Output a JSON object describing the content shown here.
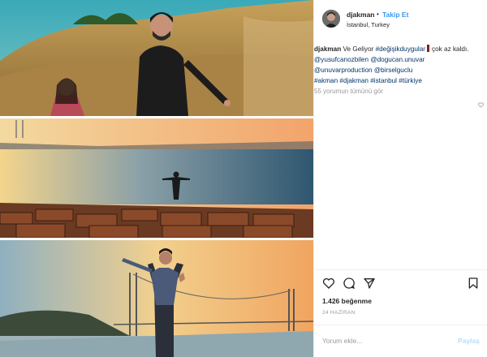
{
  "header": {
    "username": "djakman",
    "separator": "•",
    "follow_label": "Takip Et",
    "location": "İstanbul, Turkey"
  },
  "caption": {
    "username": "djakman",
    "text1": "Ve Geliyor",
    "hashtag1": "#değişikduygular",
    "text2": "çok az kaldı.",
    "mention1": "@yusufcanozbilen",
    "mention2": "@dogucan.unuvar",
    "mention3": "@unuvarproduction",
    "mention4": "@birselguclu",
    "hashtag2": "#akman",
    "hashtag3": "#djakman",
    "hashtag4": "#istanbul",
    "hashtag5": "#türkiye",
    "view_all": "55 yorumun tümünü gör"
  },
  "stats": {
    "likes": "1.426 beğenme",
    "date": "24 HAZİRAN"
  },
  "comment_box": {
    "placeholder": "Yorum ekle...",
    "post_label": "Paylaş"
  },
  "icons": [
    "heart-icon",
    "comment-icon",
    "share-icon",
    "bookmark-icon",
    "small-heart-icon"
  ],
  "colors": {
    "link": "#003569",
    "follow": "#3897f0",
    "muted": "#999999"
  }
}
